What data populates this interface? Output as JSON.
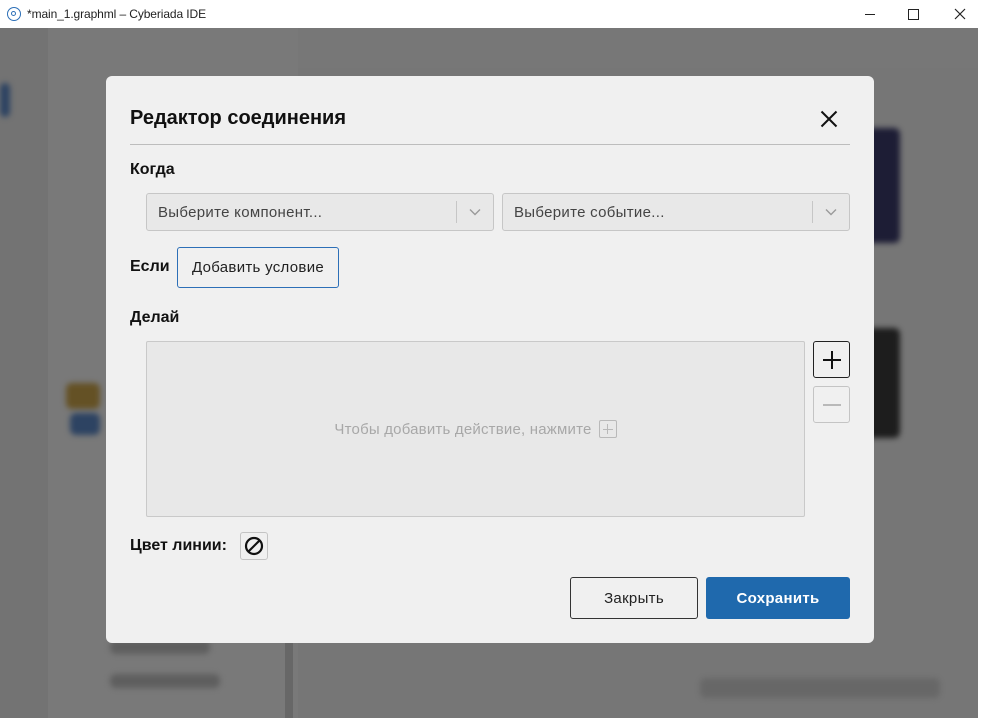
{
  "window": {
    "title": "*main_1.graphml – Cyberiada IDE",
    "controls": {
      "minimize": "minimize-icon",
      "maximize": "maximize-icon",
      "close": "close-icon"
    }
  },
  "dialog": {
    "title": "Редактор соединения",
    "close_icon": "close-icon",
    "when": {
      "label": "Когда",
      "component_placeholder": "Выберите компонент...",
      "event_placeholder": "Выберите событие..."
    },
    "if": {
      "label": "Если",
      "add_condition_label": "Добавить условие"
    },
    "do": {
      "label": "Делай",
      "empty_hint": "Чтобы добавить действие, нажмите",
      "add_icon": "plus-icon",
      "remove_icon": "minus-icon"
    },
    "line_color": {
      "label": "Цвет линии:",
      "icon": "no-color-icon"
    },
    "footer": {
      "close_label": "Закрыть",
      "save_label": "Сохранить"
    }
  },
  "colors": {
    "accent": "#1f69ad",
    "dialog_bg": "#f0f0f0",
    "overlay": "rgba(0,0,0,0.5)"
  }
}
